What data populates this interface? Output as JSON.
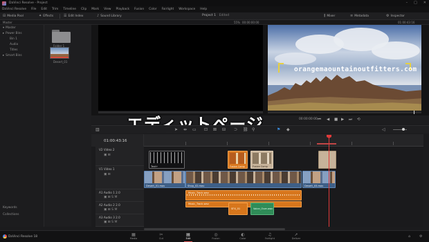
{
  "window": {
    "title": "DaVinci Resolve - Project",
    "controls": [
      "–",
      "□",
      "✕"
    ]
  },
  "menu": [
    "DaVinci Resolve",
    "File",
    "Edit",
    "Trim",
    "Timeline",
    "Clip",
    "Mark",
    "View",
    "Playback",
    "Fusion",
    "Color",
    "Fairlight",
    "Workspace",
    "Help"
  ],
  "toolbar": {
    "media_pool": "Media Pool",
    "effects": "Effects",
    "edit_index": "Edit Index",
    "sound_library": "Sound Library",
    "project_name": "Project 1",
    "edited": "Edited",
    "timeline_name": "Timeline 1",
    "mixer": "Mixer",
    "metadata": "Metadata",
    "inspector": "Inspector"
  },
  "subbar": {
    "left": "Master",
    "zoom": "55%",
    "source_tc": "00:00:00:00",
    "timeline_tc": "01:00:43:16"
  },
  "media_tree": {
    "items": [
      {
        "label": "Master",
        "indent": false
      },
      {
        "label": "Power Bins",
        "indent": false
      },
      {
        "label": "Bin 1",
        "indent": true
      },
      {
        "label": "Audio",
        "indent": true
      },
      {
        "label": "Titles",
        "indent": true
      },
      {
        "label": "Smart Bins",
        "indent": false
      }
    ],
    "bottom_1": "Keywords",
    "bottom_2": "Collections"
  },
  "media_pool": {
    "folder_label": "Folder 1",
    "clip_label": "Desert_01"
  },
  "viewer": {
    "overlay_title": "orangemaountainoutfitters.com"
  },
  "overlay_caption": "エディットページ",
  "controls": {
    "play_icons": [
      "⏮",
      "◀",
      "■",
      "▶",
      "⏭",
      "⟲"
    ],
    "tc_right": "00:00:00:00",
    "volume": "◁ ━━"
  },
  "timeline": {
    "timecode": "01:00:43:16",
    "tracks": [
      {
        "id": "v2",
        "name": "V2  Video 2",
        "icons": "▣  ⊞"
      },
      {
        "id": "v1",
        "name": "V1  Video 1",
        "icons": "▣  ⊞"
      },
      {
        "id": "a1",
        "name": "A1  Audio 1   2.0",
        "icons": "▣ ⊞  S  M"
      },
      {
        "id": "a2",
        "name": "A2  Audio 2   2.0",
        "icons": "▣ ⊞  S  M"
      },
      {
        "id": "a3",
        "name": "A3  Audio 3   2.0",
        "icons": "▣ ⊞  S  M"
      }
    ],
    "clips": {
      "title1": "Text+",
      "fusion1": "Fusion Comp",
      "fusion2": "Fusion Comp",
      "v1_a": "Desert_01.mov",
      "v1_b": "Shop_02.mov",
      "v1_c": "Desert_03.mov",
      "a1": "Music_Track.wav",
      "a2": "Music_Track.wav",
      "a3_orange": "SFX_01",
      "a3_green": "Voice_Over.wav"
    }
  },
  "pages": [
    {
      "icon": "▦",
      "label": "Media"
    },
    {
      "icon": "✂",
      "label": "Cut"
    },
    {
      "icon": "▤",
      "label": "Edit",
      "active": true
    },
    {
      "icon": "◎",
      "label": "Fusion"
    },
    {
      "icon": "◐",
      "label": "Color"
    },
    {
      "icon": "♫",
      "label": "Fairlight"
    },
    {
      "icon": "➚",
      "label": "Deliver"
    }
  ],
  "brand": "DaVinci Resolve 18",
  "colors": {
    "accent": "#3b8de0",
    "playhead": "#e03a3a",
    "fusion": "#d9781f",
    "video": "#3e5f87",
    "audio_green": "#2f8c58"
  }
}
